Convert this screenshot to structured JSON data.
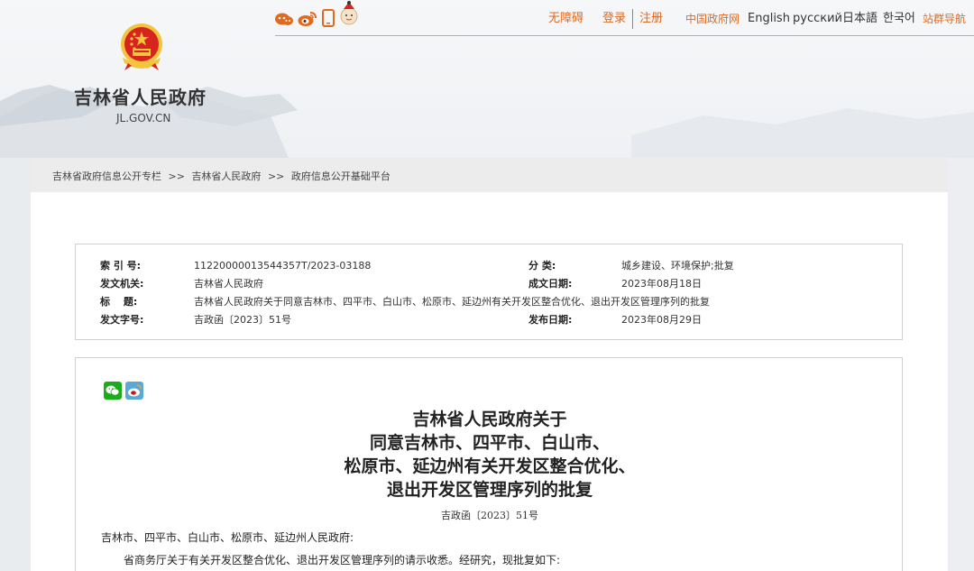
{
  "top_nav": {
    "accessibility": "无障碍",
    "login": "登录",
    "register": "注册",
    "gov_cn": "中国政府网",
    "english": "English",
    "russian": "русский",
    "japanese": "日本語",
    "korean": "한국어",
    "site_nav": "站群导航"
  },
  "social_icons": [
    "weibo-app-icon",
    "sina-weibo-icon",
    "mobile-phone-icon",
    "mascot-icon"
  ],
  "header": {
    "site_title": "吉林省人民政府",
    "site_domain": "JL.GOV.CN"
  },
  "breadcrumb": [
    "吉林省政府信息公开专栏",
    ">>",
    "吉林省人民政府",
    ">>",
    "政府信息公开基础平台"
  ],
  "meta": {
    "index_label": "索 引 号:",
    "index_value": "11220000013544357T/2023-03188",
    "category_label": "分 类:",
    "category_value": "城乡建设、环境保护;批复",
    "issuer_label": "发文机关:",
    "issuer_value": "吉林省人民政府",
    "created_label": "成文日期:",
    "created_value": "2023年08月18日",
    "title_label": "标　 题:",
    "title_value": "吉林省人民政府关于同意吉林市、四平市、白山市、松原市、延边州有关开发区整合优化、退出开发区管理序列的批复",
    "docno_label": "发文字号:",
    "docno_value": "吉政函〔2023〕51号",
    "published_label": "发布日期:",
    "published_value": "2023年08月29日"
  },
  "article": {
    "title_lines": [
      "吉林省人民政府关于",
      "同意吉林市、四平市、白山市、",
      "松原市、延边州有关开发区整合优化、",
      "退出开发区管理序列的批复"
    ],
    "doc_number": "吉政函〔2023〕51号",
    "salutation": "吉林市、四平市、白山市、松原市、延边州人民政府:",
    "first_paragraph": "省商务厅关于有关开发区整合优化、退出开发区管理序列的请示收悉。经研究，现批复如下:"
  },
  "colors": {
    "accent": "#e16a1f",
    "wechat": "#1aad19",
    "weibo_bg": "#5aa9d6",
    "emblem_red": "#d8241f",
    "emblem_gold": "#f2c53d"
  }
}
